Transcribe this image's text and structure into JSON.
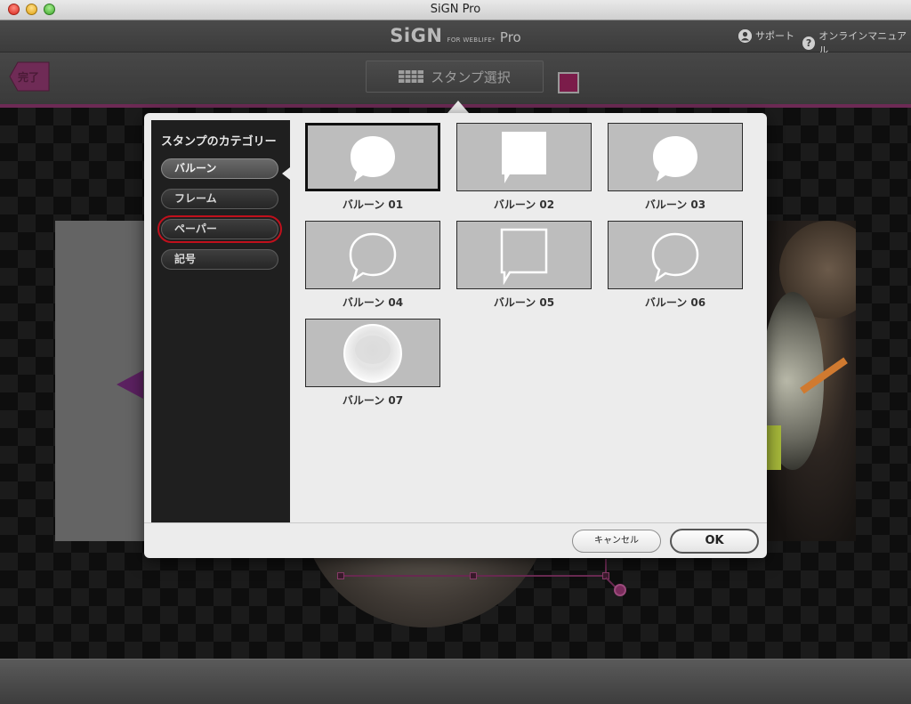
{
  "window": {
    "title": "SiGN Pro"
  },
  "header": {
    "logo_main": "SiGN",
    "logo_small": "FOR WEBLIFE*",
    "logo_pro": "Pro",
    "support": "サポート",
    "manual": "オンラインマニュアル"
  },
  "toolbar": {
    "done": "完了",
    "stamp_select": "スタンプ選択",
    "color": "#7b1c4a"
  },
  "dialog": {
    "category_title": "スタンプのカテゴリー",
    "categories": [
      {
        "label": "バルーン",
        "state": "selected"
      },
      {
        "label": "フレーム",
        "state": "normal"
      },
      {
        "label": "ペーパー",
        "state": "focused"
      },
      {
        "label": "記号",
        "state": "normal"
      }
    ],
    "stamps": [
      {
        "label": "バルーン 01",
        "icon": "round-balloon-filled-icon",
        "selected": true
      },
      {
        "label": "バルーン 02",
        "icon": "square-balloon-filled-icon",
        "selected": false
      },
      {
        "label": "バルーン 03",
        "icon": "round-balloon-filled-icon",
        "selected": false
      },
      {
        "label": "バルーン 04",
        "icon": "round-balloon-outline-icon",
        "selected": false
      },
      {
        "label": "バルーン 05",
        "icon": "square-balloon-outline-icon",
        "selected": false
      },
      {
        "label": "バルーン 06",
        "icon": "round-balloon-outline-icon",
        "selected": false
      },
      {
        "label": "バルーン 07",
        "icon": "glossy-circle-balloon-icon",
        "selected": false
      }
    ],
    "cancel": "キャンセル",
    "ok": "OK"
  }
}
